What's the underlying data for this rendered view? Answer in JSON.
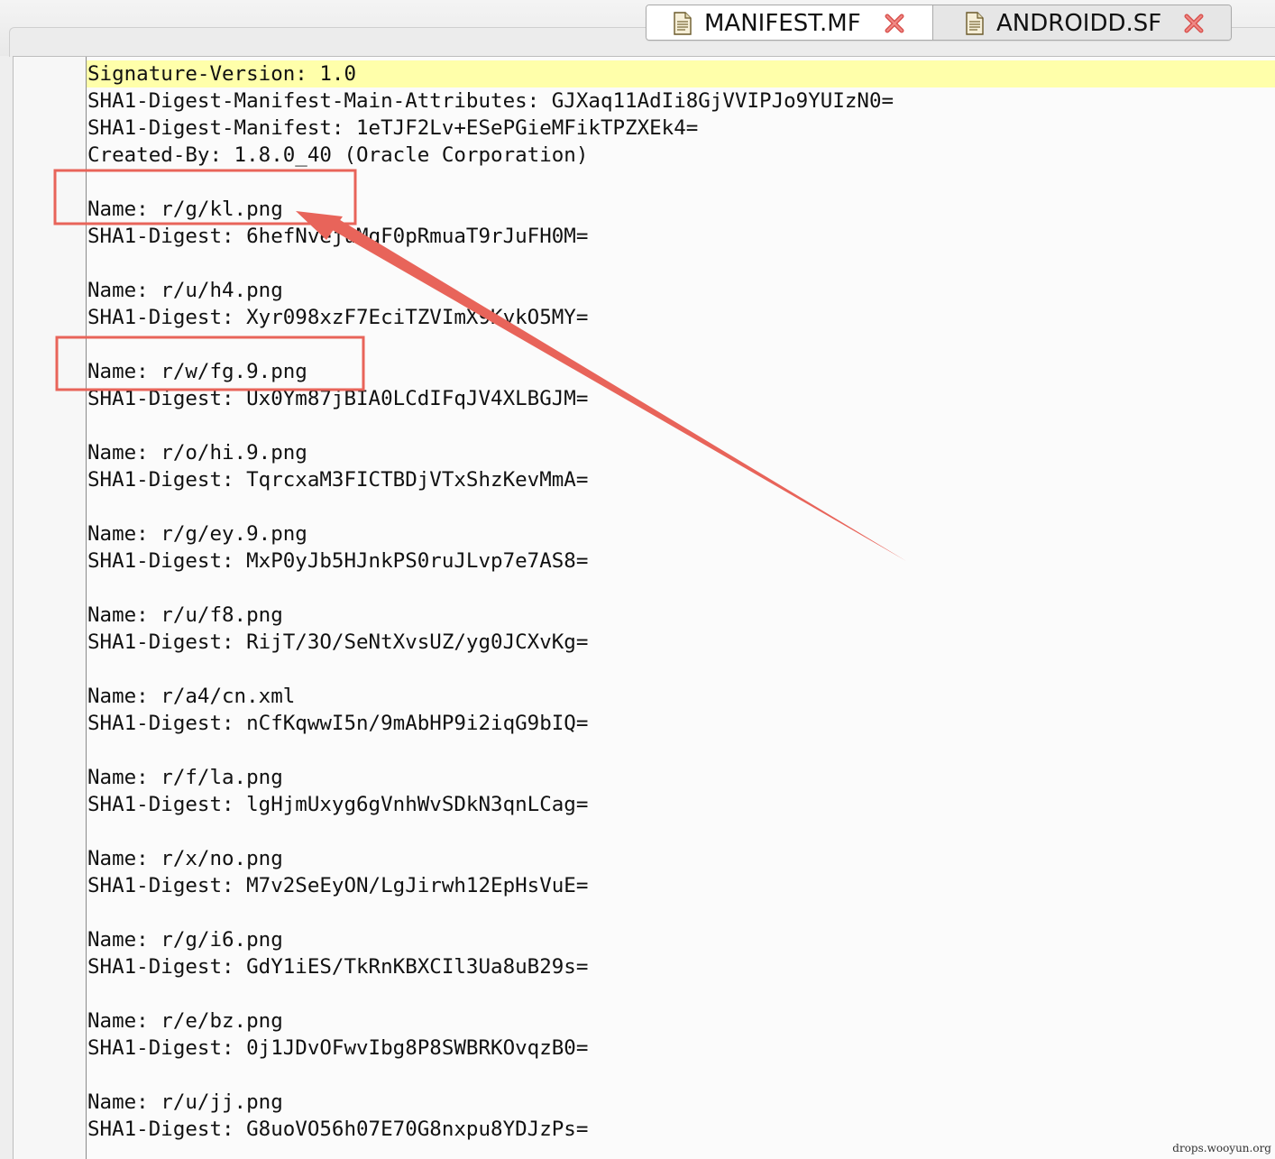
{
  "tabs": [
    {
      "label": "MANIFEST.MF",
      "icon": "document-icon",
      "close_icon": "close-icon",
      "active": true
    },
    {
      "label": "ANDROIDD.SF",
      "icon": "document-icon",
      "close_icon": "close-icon",
      "active": false
    }
  ],
  "editor": {
    "lines": [
      "Signature-Version: 1.0",
      "SHA1-Digest-Manifest-Main-Attributes: GJXaq11AdIi8GjVVIPJo9YUIzN0=",
      "SHA1-Digest-Manifest: 1eTJF2Lv+ESePGieMFikTPZXEk4=",
      "Created-By: 1.8.0_40 (Oracle Corporation)",
      "",
      "Name: r/g/kl.png",
      "SHA1-Digest: 6hefNvejuMqF0pRmuaT9rJuFH0M=",
      "",
      "Name: r/u/h4.png",
      "SHA1-Digest: Xyr098xzF7EciTZVImX9KykO5MY=",
      "",
      "Name: r/w/fg.9.png",
      "SHA1-Digest: Ux0Ym87jBIA0LCdIFqJV4XLBGJM=",
      "",
      "Name: r/o/hi.9.png",
      "SHA1-Digest: TqrcxaM3FICTBDjVTxShzKevMmA=",
      "",
      "Name: r/g/ey.9.png",
      "SHA1-Digest: MxP0yJb5HJnkPS0ruJLvp7e7AS8=",
      "",
      "Name: r/u/f8.png",
      "SHA1-Digest: RijT/3O/SeNtXvsUZ/yg0JCXvKg=",
      "",
      "Name: r/a4/cn.xml",
      "SHA1-Digest: nCfKqwwI5n/9mAbHP9i2iqG9bIQ=",
      "",
      "Name: r/f/la.png",
      "SHA1-Digest: lgHjmUxyg6gVnhWvSDkN3qnLCag=",
      "",
      "Name: r/x/no.png",
      "SHA1-Digest: M7v2SeEyON/LgJirwh12EpHsVuE=",
      "",
      "Name: r/g/i6.png",
      "SHA1-Digest: GdY1iES/TkRnKBXCIl3Ua8uB29s=",
      "",
      "Name: r/e/bz.png",
      "SHA1-Digest: 0j1JDvOFwvIbg8P8SWBRKOvqzB0=",
      "",
      "Name: r/u/jj.png",
      "SHA1-Digest: G8uoVO56h07E70G8nxpu8YDJzPs="
    ],
    "current_line_color": "#ffffaa"
  },
  "annotations": {
    "color": "#e8645a",
    "highlight_boxes": [
      "Name: r/g/kl.png",
      "Name: r/w/fg.9.png"
    ],
    "arrow_target": "Name: r/g/kl.png"
  },
  "watermark": "drops.wooyun.org"
}
